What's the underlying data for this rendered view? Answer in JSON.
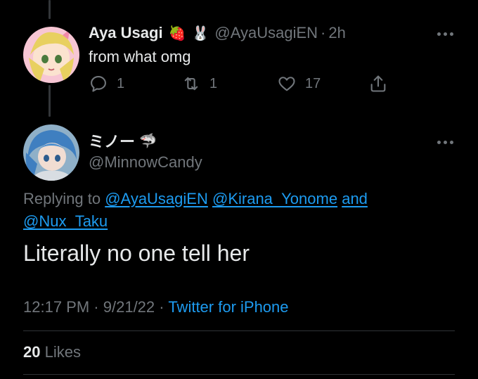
{
  "parent_tweet": {
    "display_name": "Aya Usagi",
    "emojis": [
      "🍓",
      "🐰"
    ],
    "handle": "@AyaUsagiEN",
    "separator": "·",
    "time": "2h",
    "text": "from what omg",
    "reply_count": "1",
    "retweet_count": "1",
    "like_count": "17"
  },
  "main_tweet": {
    "display_name": "ミノー",
    "emoji": "🦈",
    "handle": "@MinnowCandy",
    "replying_to_prefix": "Replying to",
    "replying_to_users": [
      "@AyaUsagiEN",
      "@Kirana_Yonome"
    ],
    "replying_to_and": "and",
    "replying_to_last": "@Nux_Taku",
    "text": "Literally no one tell her",
    "time": "12:17 PM",
    "date": "9/21/22",
    "dot": "·",
    "client": "Twitter for iPhone",
    "likes_count": "20",
    "likes_label": "Likes"
  },
  "colors": {
    "background": "#000000",
    "text": "#e7e9ea",
    "muted": "#71767b",
    "link": "#1d9bf0",
    "divider": "#2f3336"
  }
}
